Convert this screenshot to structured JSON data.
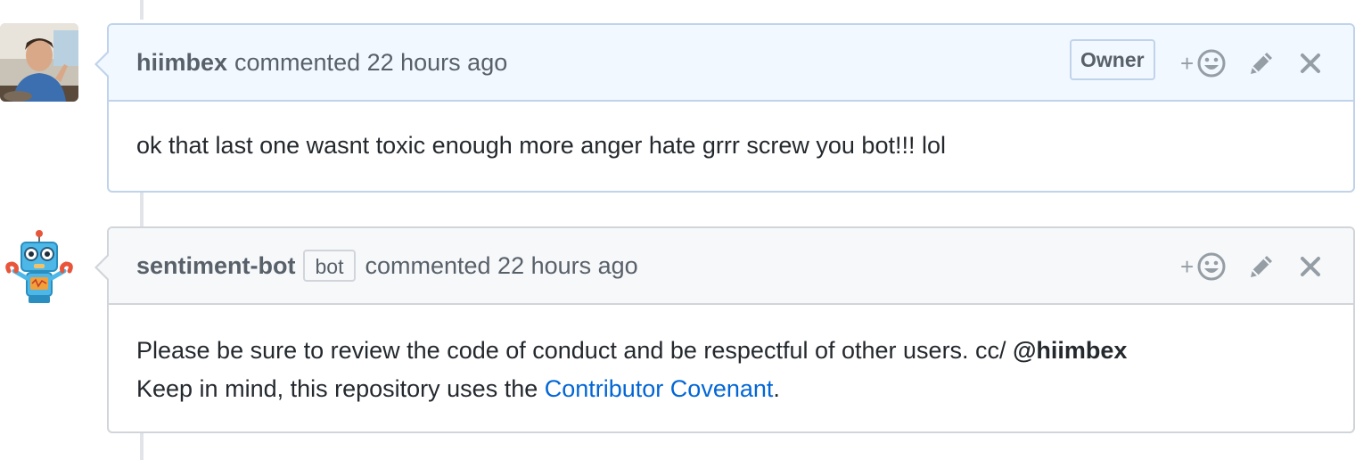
{
  "comments": [
    {
      "author": "hiimbex",
      "meta": "commented 22 hours ago",
      "badge": "Owner",
      "body": "ok that last one wasnt toxic enough more anger hate grrr screw you bot!!! lol"
    },
    {
      "author": "sentiment-bot",
      "bot_label": "bot",
      "meta": "commented 22 hours ago",
      "body_line1": "Please be sure to review the code of conduct and be respectful of other users. cc/ ",
      "mention": "@hiimbex",
      "body_line2_prefix": "Keep in mind, this repository uses the ",
      "link_text": "Contributor Covenant",
      "body_line2_suffix": "."
    }
  ],
  "actions": {
    "reaction_plus": "+",
    "icons": [
      "add-reaction-icon",
      "pencil-icon",
      "close-icon"
    ]
  },
  "colors": {
    "owner_header_bg": "#f1f8ff",
    "header_bg": "#f6f8fa",
    "link": "#0366d6",
    "muted": "#586069",
    "icon": "#959da5"
  }
}
